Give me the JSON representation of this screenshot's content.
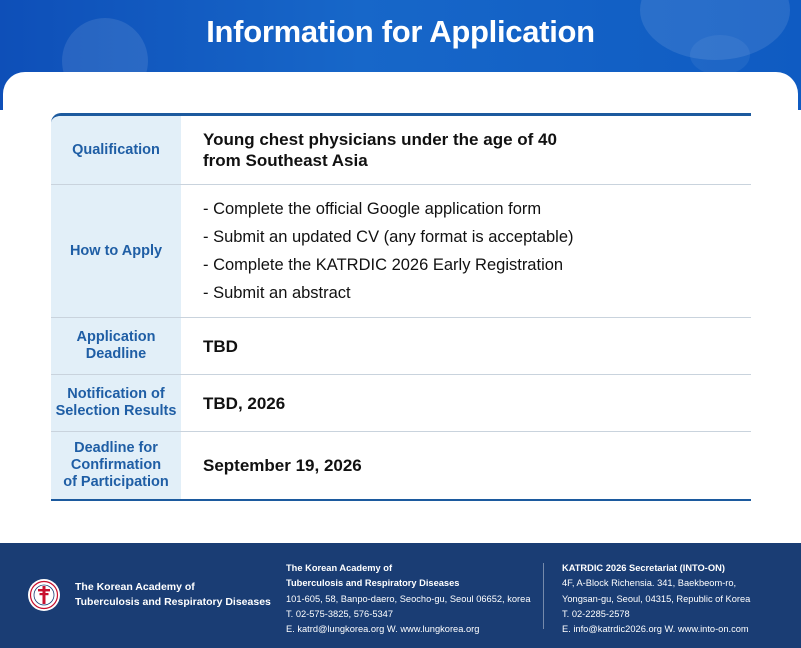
{
  "header": {
    "title": "Information for Application"
  },
  "rows": [
    {
      "label": "Qualification",
      "value": [
        "Young chest physicians under the age of 40",
        "from Southeast Asia"
      ]
    },
    {
      "label": "How to Apply",
      "items": [
        "- Complete the official Google application form",
        "- Submit an updated CV (any format is acceptable)",
        "- Complete the KATRDIC 2026 Early Registration",
        "- Submit an abstract"
      ]
    },
    {
      "label": [
        "Application",
        "Deadline"
      ],
      "value": "TBD"
    },
    {
      "label": [
        "Notification of",
        "Selection Results"
      ],
      "value": "TBD, 2026"
    },
    {
      "label": [
        "Deadline for",
        "Confirmation",
        "of Participation"
      ],
      "value": "September 19, 2026"
    }
  ],
  "footer": {
    "logo_icon": "academy-seal-icon",
    "org_name": [
      "The Korean Academy of",
      "Tuberculosis and Respiratory Diseases"
    ],
    "col1": {
      "title": [
        "The Korean Academy of",
        "Tuberculosis and Respiratory Diseases"
      ],
      "address": "101-605, 58, Banpo-daero, Seocho-gu, Seoul 06652, korea",
      "phone": "T. 02-575-3825, 576-5347",
      "contact": "E. katrd@lungkorea.org  W. www.lungkorea.org"
    },
    "col2": {
      "title": "KATRDIC 2026 Secretariat (INTO-ON)",
      "address": [
        "4F, A-Block Richensia. 341, Baekbeom-ro,",
        "Yongsan-gu, Seoul, 04315, Republic of Korea"
      ],
      "phone": "T. 02-2285-2578",
      "contact": "E. info@katrdic2026.org  W. www.into-on.com"
    }
  },
  "colors": {
    "header_blue": "#1767c9",
    "label_bg": "#e2eff8",
    "label_text": "#1f5ea5",
    "footer_bg": "#1a3d74"
  }
}
